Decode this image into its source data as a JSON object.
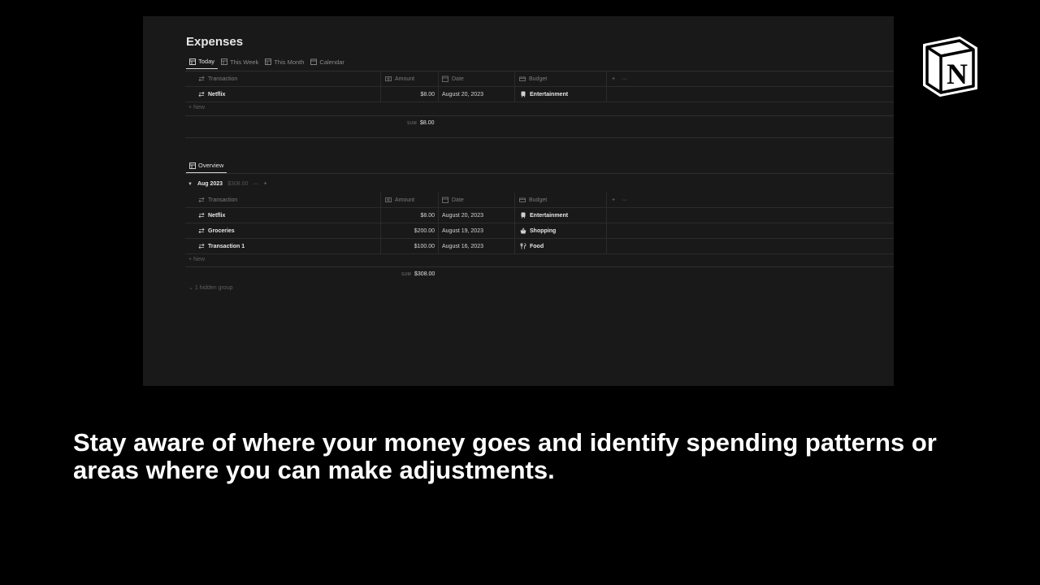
{
  "page": {
    "title": "Expenses",
    "tabs": [
      {
        "label": "Today",
        "active": true
      },
      {
        "label": "This Week",
        "active": false
      },
      {
        "label": "This Month",
        "active": false
      },
      {
        "label": "Calendar",
        "active": false
      }
    ]
  },
  "columns": {
    "transaction": "Transaction",
    "amount": "Amount",
    "date": "Date",
    "budget": "Budget"
  },
  "today": {
    "rows": [
      {
        "transaction": "Netflix",
        "amount": "$8.00",
        "date": "August 20, 2023",
        "budget": "Entertainment",
        "budget_icon": "train-icon"
      }
    ],
    "new_label": "+ New",
    "sum_label": "SUM",
    "sum_value": "$8.00"
  },
  "overview": {
    "tab_label": "Overview",
    "group": {
      "name": "Aug 2023",
      "total": "$308.00"
    },
    "rows": [
      {
        "transaction": "Netflix",
        "amount": "$8.00",
        "date": "August 20, 2023",
        "budget": "Entertainment",
        "budget_icon": "train-icon"
      },
      {
        "transaction": "Groceries",
        "amount": "$200.00",
        "date": "August 19, 2023",
        "budget": "Shopping",
        "budget_icon": "basket-icon"
      },
      {
        "transaction": "Transaction 1",
        "amount": "$100.00",
        "date": "August 16, 2023",
        "budget": "Food",
        "budget_icon": "fork-knife-icon"
      }
    ],
    "new_label": "+ New",
    "sum_label": "SUM",
    "sum_value": "$308.00",
    "hidden_group_label": "1 hidden group"
  },
  "caption": "Stay aware of where your money goes and identify spending patterns or areas where you can make adjustments.",
  "colors": {
    "background": "#000000",
    "surface": "#191919",
    "text": "#e6e6e6"
  }
}
